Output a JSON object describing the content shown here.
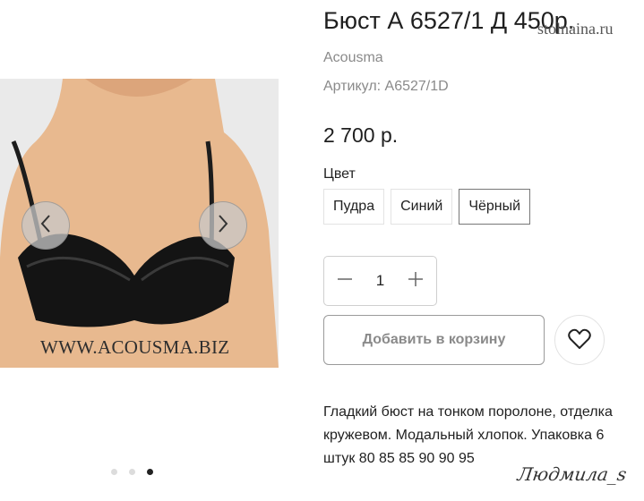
{
  "product": {
    "title": "Бюст А 6527/1 Д 450р.",
    "brand": "Acousma",
    "sku": "Артикул: A6527/1D",
    "price": "2 700 р."
  },
  "gallery": {
    "image_caption": "WWW.ACOUSMA.BIZ",
    "slides": 3,
    "active_slide": 3
  },
  "color": {
    "label": "Цвет",
    "options": [
      "Пудра",
      "Синий",
      "Чёрный"
    ],
    "selected": "Чёрный"
  },
  "quantity": {
    "value": "1"
  },
  "actions": {
    "add_to_cart": "Добавить в корзину"
  },
  "description": "Гладкий бюст на тонком поролоне, отделка кружевом. Модальный хлопок. Упаковка 6 штук 80 85 85 90 90 95",
  "watermarks": {
    "top": "stolnaina.ru",
    "bottom": "Людмила_s"
  },
  "icons": {
    "prev": "chevron-left-icon",
    "next": "chevron-right-icon",
    "minus": "minus-icon",
    "plus": "plus-icon",
    "wishlist": "heart-icon"
  }
}
